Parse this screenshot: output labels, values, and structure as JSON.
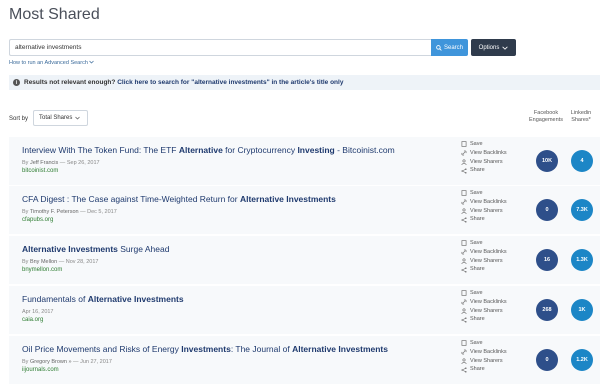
{
  "page_title": "Most Shared",
  "search": {
    "value": "alternative investments",
    "button_label": "Search",
    "options_label": "Options"
  },
  "advanced_link": "How to run an Advanced Search",
  "notice": {
    "prefix": "Results not relevant enough?",
    "link": "Click here to search for \"alternative investments\" in the article's title only"
  },
  "sort": {
    "label": "Sort by",
    "selected": "Total Shares"
  },
  "columns": {
    "facebook": "Facebook Engagements",
    "linkedin": "Linkedin Shares*"
  },
  "action_labels": {
    "save": "Save",
    "backlinks": "View Backlinks",
    "sharers": "View Sharers",
    "share": "Share"
  },
  "results": [
    {
      "title_parts": [
        {
          "text": "Interview With The Token Fund: The ETF ",
          "bold": false
        },
        {
          "text": "Alternative",
          "bold": true
        },
        {
          "text": " for Cryptocurrency ",
          "bold": false
        },
        {
          "text": "Investing",
          "bold": true
        },
        {
          "text": " - Bitcoinist.com",
          "bold": false
        }
      ],
      "author": "Jeff Francis",
      "date": "Sep 26, 2017",
      "domain": "bitcoinist.com",
      "facebook": "10K",
      "linkedin": "4"
    },
    {
      "title_parts": [
        {
          "text": "CFA Digest : The Case against Time-Weighted Return for ",
          "bold": false
        },
        {
          "text": "Alternative Investments",
          "bold": true
        }
      ],
      "author": "Timothy F. Peterson",
      "date": "Dec 5, 2017",
      "domain": "cfapubs.org",
      "facebook": "0",
      "linkedin": "7.3K"
    },
    {
      "title_parts": [
        {
          "text": "Alternative Investments",
          "bold": true
        },
        {
          "text": " Surge Ahead",
          "bold": false
        }
      ],
      "author": "Bny Mellon",
      "date": "Nov 28, 2017",
      "domain": "bnymellon.com",
      "facebook": "16",
      "linkedin": "1.3K"
    },
    {
      "title_parts": [
        {
          "text": "Fundamentals of ",
          "bold": false
        },
        {
          "text": "Alternative Investments",
          "bold": true
        }
      ],
      "author": "",
      "date": "Apr 16, 2017",
      "domain": "caia.org",
      "facebook": "268",
      "linkedin": "1K"
    },
    {
      "title_parts": [
        {
          "text": "Oil Price Movements and Risks of Energy ",
          "bold": false
        },
        {
          "text": "Investments",
          "bold": true
        },
        {
          "text": ": The Journal of ",
          "bold": false
        },
        {
          "text": "Alternative Investments",
          "bold": true
        }
      ],
      "author": "Gregory Brown »",
      "date": "Jun 27, 2017",
      "domain": "iijournals.com",
      "facebook": "0",
      "linkedin": "1.2K"
    }
  ]
}
